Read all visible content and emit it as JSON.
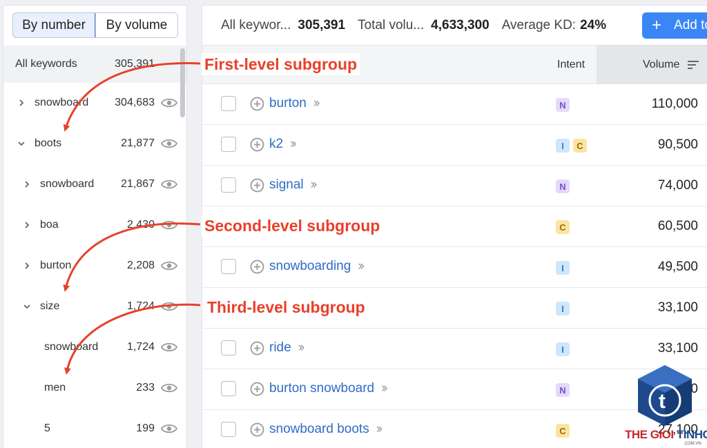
{
  "toggle": {
    "by_number": "By number",
    "by_volume": "By volume"
  },
  "left": {
    "all_keywords_label": "All keywords",
    "all_keywords_count": "305,391",
    "rows": [
      {
        "label": "snowboard",
        "count": "304,683",
        "chevron": "right",
        "level": 1
      },
      {
        "label": "boots",
        "count": "21,877",
        "chevron": "down",
        "level": 1
      },
      {
        "label": "snowboard",
        "count": "21,867",
        "chevron": "right",
        "level": 2
      },
      {
        "label": "boa",
        "count": "2,430",
        "chevron": "right",
        "level": 2
      },
      {
        "label": "burton",
        "count": "2,208",
        "chevron": "right",
        "level": 2
      },
      {
        "label": "size",
        "count": "1,724",
        "chevron": "down",
        "level": 2
      },
      {
        "label": "snowboard",
        "count": "1,724",
        "chevron": "none",
        "level": 3
      },
      {
        "label": "men",
        "count": "233",
        "chevron": "none",
        "level": 3
      },
      {
        "label": "5",
        "count": "199",
        "chevron": "none",
        "level": 3
      }
    ]
  },
  "summary": {
    "all_keywords_label": "All keywor...",
    "all_keywords_value": "305,391",
    "total_volume_label": "Total volu...",
    "total_volume_value": "4,633,300",
    "avg_kd_label": "Average KD:",
    "avg_kd_value": "24%",
    "add_button_label": "Add to"
  },
  "table": {
    "intent_header": "Intent",
    "volume_header": "Volume",
    "rows": [
      {
        "keyword": "burton",
        "intents": [
          "N"
        ],
        "volume": "110,000"
      },
      {
        "keyword": "k2",
        "intents": [
          "I",
          "C"
        ],
        "volume": "90,500"
      },
      {
        "keyword": "signal",
        "intents": [
          "N"
        ],
        "volume": "74,000"
      },
      {
        "keyword": "",
        "intents": [
          "C"
        ],
        "volume": "60,500"
      },
      {
        "keyword": "snowboarding",
        "intents": [
          "I"
        ],
        "volume": "49,500"
      },
      {
        "keyword": "",
        "intents": [
          "I"
        ],
        "volume": "33,100"
      },
      {
        "keyword": "ride",
        "intents": [
          "I"
        ],
        "volume": "33,100"
      },
      {
        "keyword": "burton snowboard",
        "intents": [
          "N"
        ],
        "volume": "27,100"
      },
      {
        "keyword": "snowboard boots",
        "intents": [
          "C"
        ],
        "volume": "27,100"
      }
    ]
  },
  "annotations": {
    "first": "First-level subgroup",
    "second": "Second-level subgroup",
    "third": "Third-level subgroup"
  },
  "watermark": {
    "part1": "THE GIOI ",
    "part2": "TINHOC",
    "sub": ".COM.VN",
    "logo_letter": "t"
  },
  "colors": {
    "accent": "#3a86f5",
    "link": "#2f6bc6",
    "annotation": "#e8402a"
  }
}
